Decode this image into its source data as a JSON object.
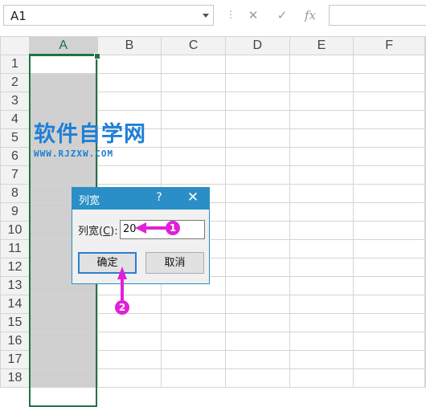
{
  "formula_bar": {
    "name_box": "A1",
    "cancel_icon": "✕",
    "enter_icon": "✓",
    "fx_label": "fx",
    "formula_value": ""
  },
  "grid": {
    "columns": [
      "A",
      "B",
      "C",
      "D",
      "E",
      "F"
    ],
    "selected_column": "A",
    "rows": [
      "1",
      "2",
      "3",
      "4",
      "5",
      "6",
      "7",
      "8",
      "9",
      "10",
      "11",
      "12",
      "13",
      "14",
      "15",
      "16",
      "17",
      "18"
    ]
  },
  "watermark": {
    "title": "软件自学网",
    "url": "WWW.RJZXW.COM"
  },
  "dialog": {
    "title": "列宽",
    "help": "?",
    "close": "✕",
    "field_label_prefix": "列宽(",
    "field_label_key": "C",
    "field_label_suffix": "):",
    "field_value": "20",
    "ok_label": "确定",
    "cancel_label": "取消"
  },
  "annotations": {
    "marker_1": "1",
    "marker_2": "2",
    "color": "#e020d8"
  },
  "colors": {
    "accent": "#217346",
    "dialog_title": "#2a8fc6"
  }
}
